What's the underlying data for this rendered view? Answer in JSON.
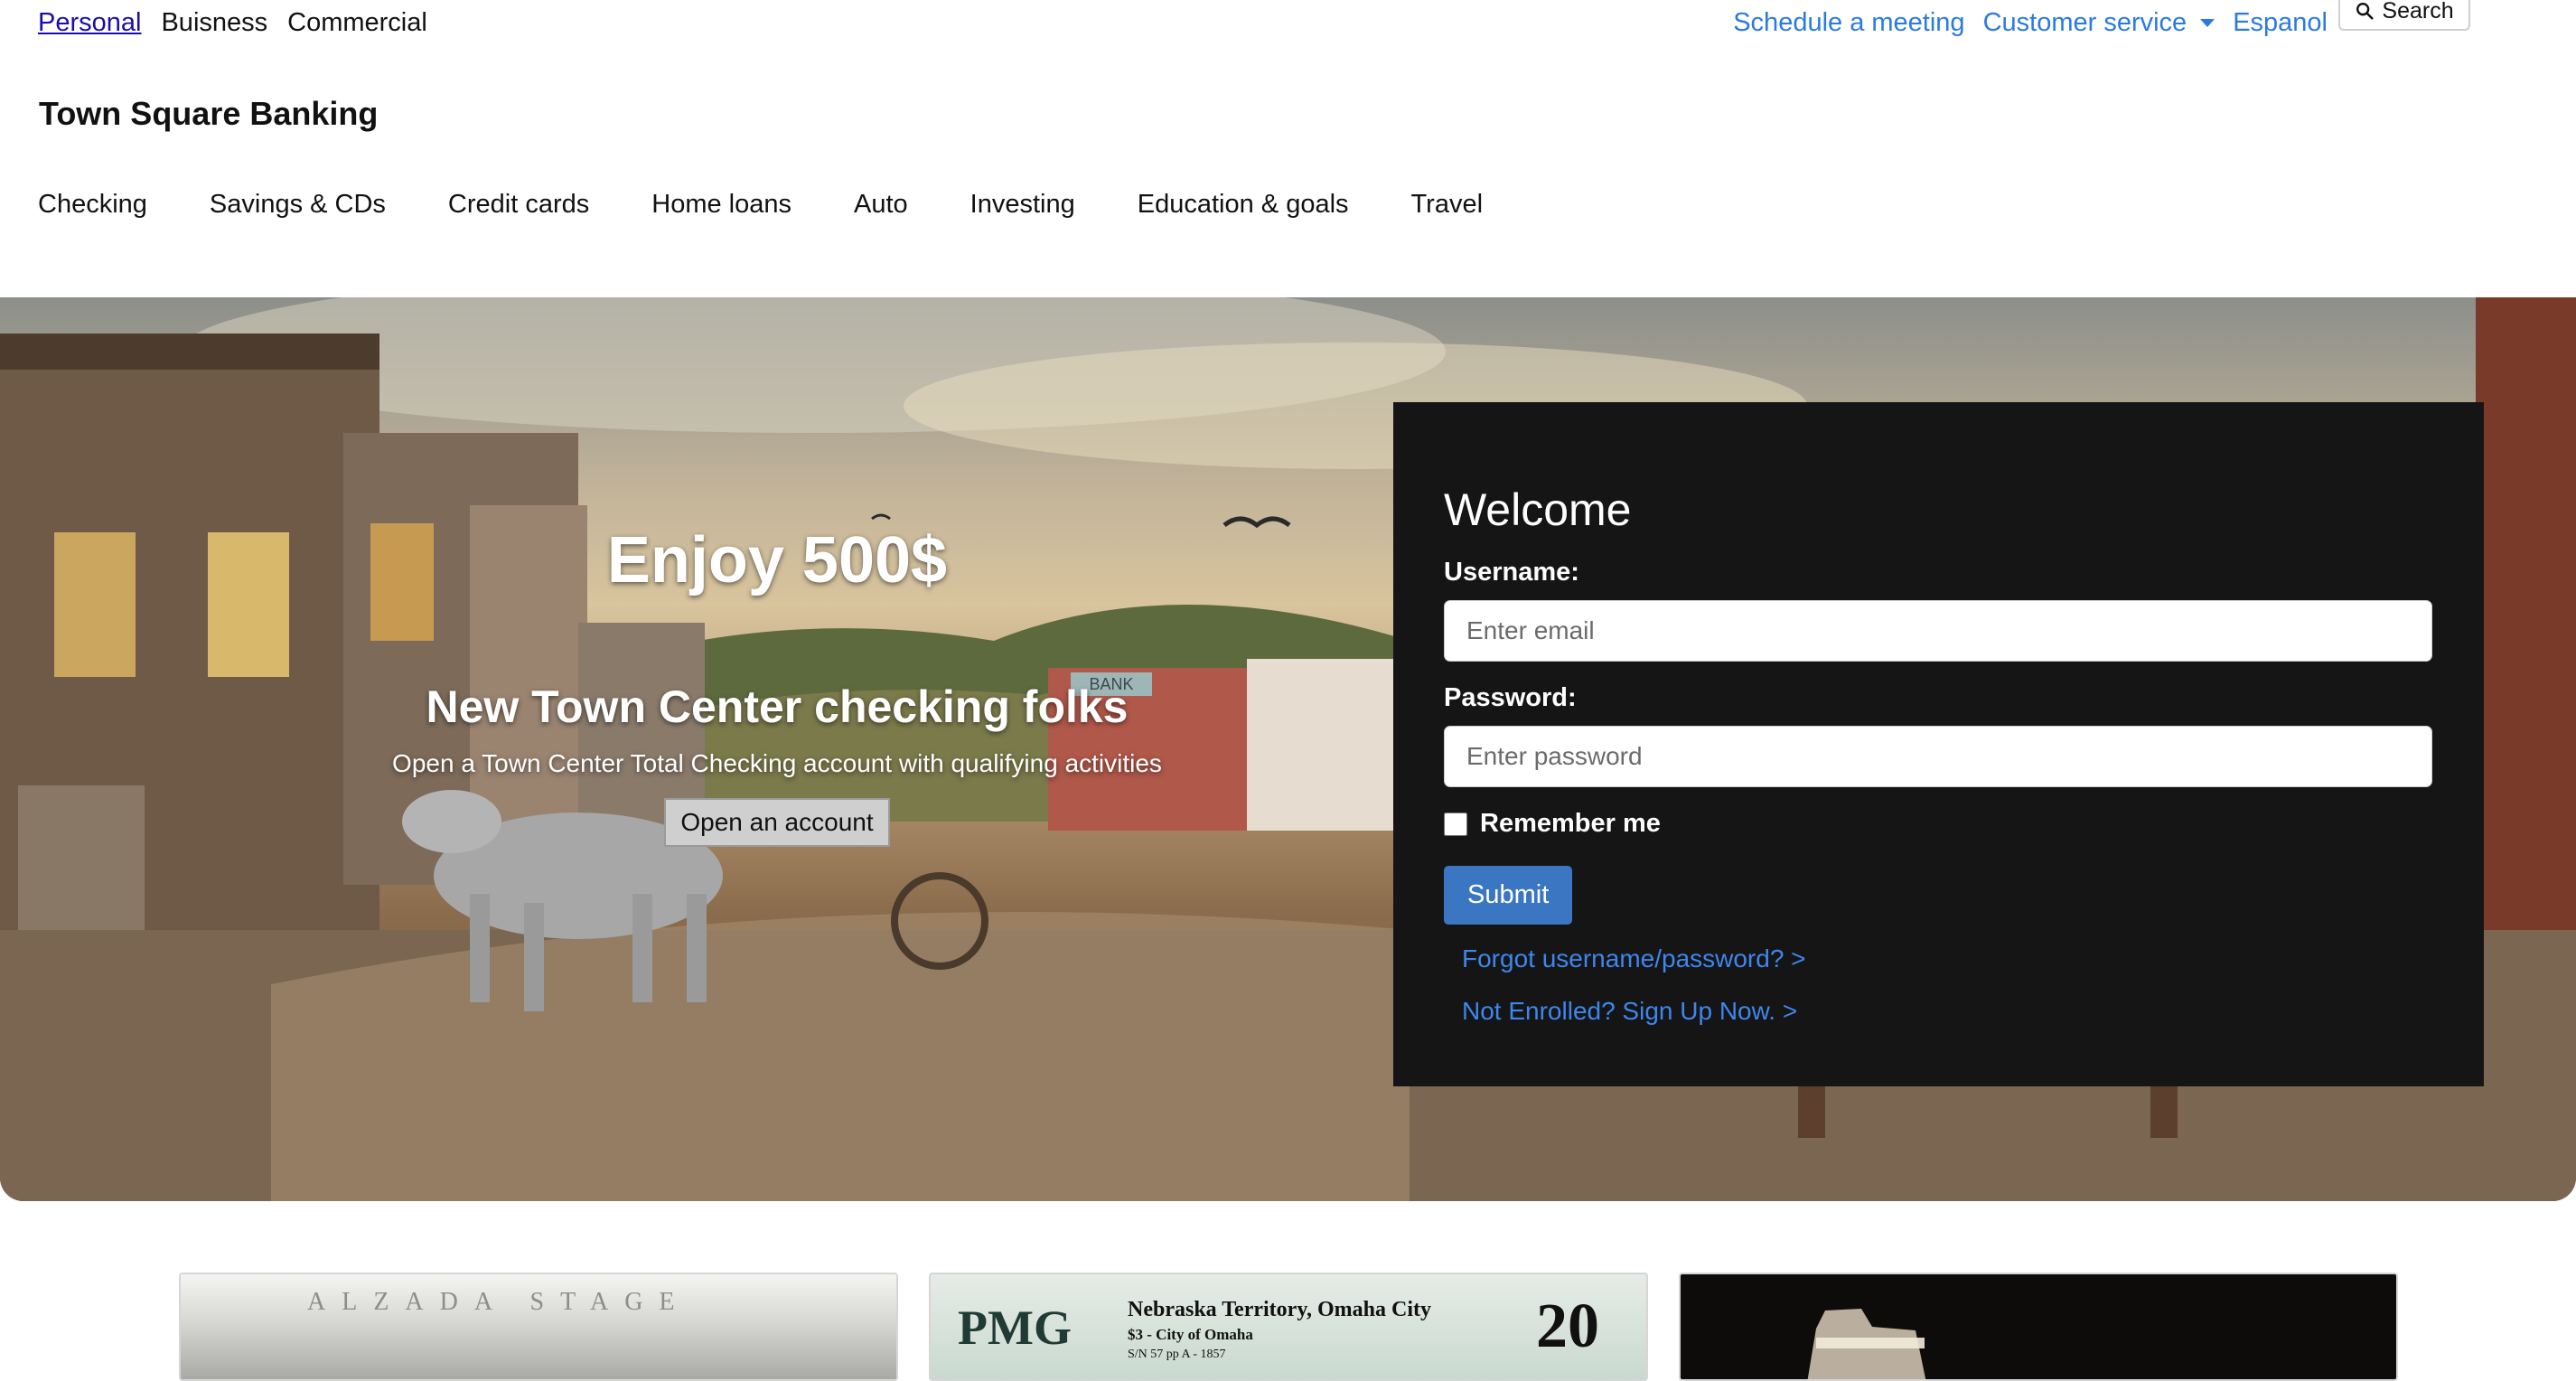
{
  "top_bar": {
    "segments": [
      {
        "label": "Personal",
        "active": true
      },
      {
        "label": "Buisness",
        "active": false
      },
      {
        "label": "Commercial",
        "active": false
      }
    ],
    "utility_links": {
      "schedule": "Schedule a meeting",
      "customer_service": "Customer service",
      "espanol": "Espanol"
    },
    "search_label": "Search",
    "search_icon": "magnifier-icon"
  },
  "brand": {
    "name": "Town Square Banking"
  },
  "main_nav": [
    "Checking",
    "Savings & CDs",
    "Credit cards",
    "Home loans",
    "Auto",
    "Investing",
    "Education & goals",
    "Travel"
  ],
  "hero": {
    "headline": "Enjoy 500$",
    "title": "New Town Center checking folks",
    "subtitle": "Open a Town Center Total Checking account with qualifying activities",
    "cta_label": "Open an account",
    "sign_bank": "BANK"
  },
  "login": {
    "title": "Welcome",
    "username_label": "Username:",
    "username_placeholder": "Enter email",
    "password_label": "Password:",
    "password_placeholder": "Enter password",
    "remember_label": "Remember me",
    "remember_checked": false,
    "submit_label": "Submit",
    "forgot_link": "Forgot username/password? >",
    "enroll_link": "Not Enrolled? Sign Up Now. >"
  },
  "cards": {
    "stage_stamp": "ALZADA STAGE",
    "pmg_logo": "PMG",
    "pmg_title": "Nebraska Territory, Omaha City",
    "pmg_line2": "$3 - City of Omaha",
    "pmg_line3": "S/N 57 pp A - 1857",
    "pmg_grade": "20"
  },
  "colors": {
    "link_blue": "#2a7ae2",
    "login_bg": "#151515",
    "submit_bg": "#3b76c2",
    "login_link": "#3e86ee"
  }
}
